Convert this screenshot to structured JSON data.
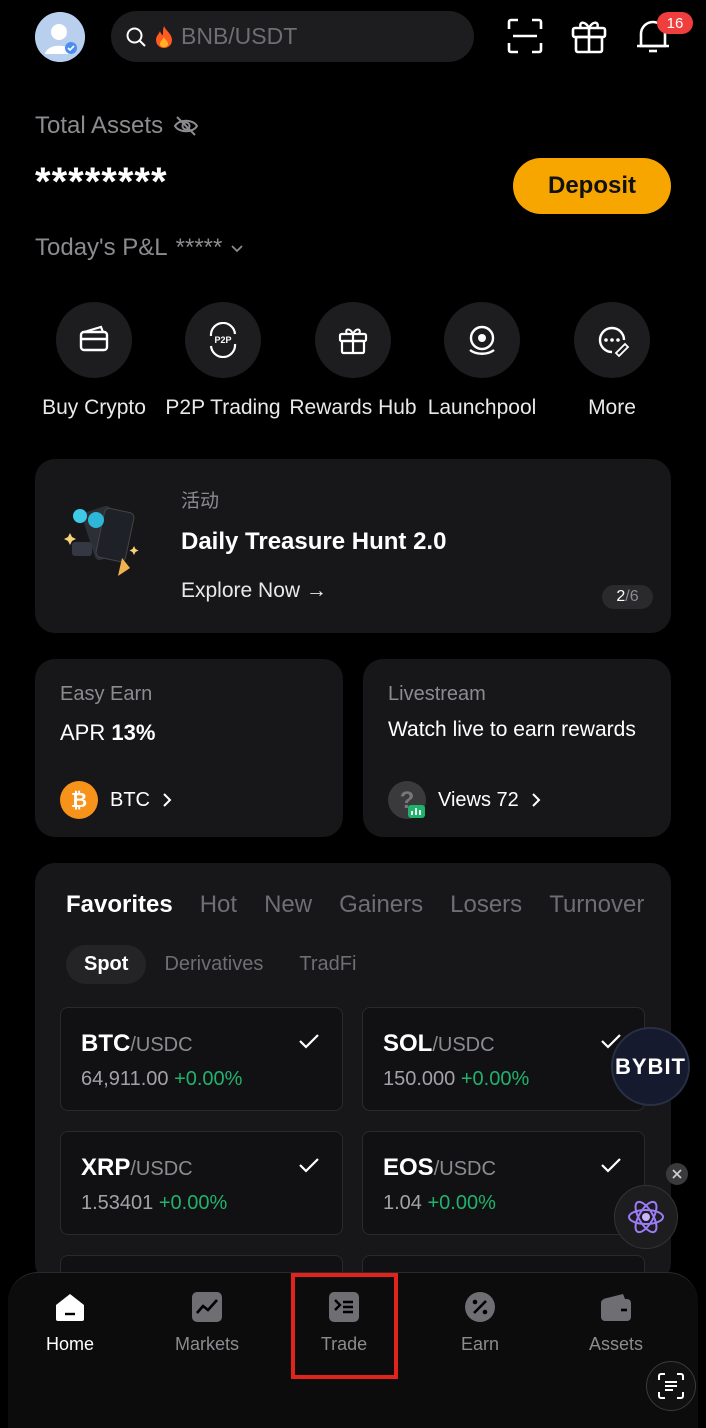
{
  "header": {
    "search_placeholder": "BNB/USDT",
    "notification_count": "16"
  },
  "assets": {
    "total_label": "Total Assets",
    "masked_value": "********",
    "deposit_label": "Deposit",
    "pnl_label": "Today's P&L",
    "pnl_value": "*****"
  },
  "shortcuts": [
    {
      "label": "Buy Crypto"
    },
    {
      "label": "P2P Trading"
    },
    {
      "label": "Rewards Hub"
    },
    {
      "label": "Launchpool"
    },
    {
      "label": "More"
    }
  ],
  "banner": {
    "tag": "活动",
    "title": "Daily Treasure Hunt 2.0",
    "link": "Explore Now →",
    "page_current": "2",
    "page_total": "/6"
  },
  "easy_earn": {
    "label": "Easy Earn",
    "apr_prefix": "APR",
    "apr_value": "13%",
    "coin": "BTC"
  },
  "livestream": {
    "label": "Livestream",
    "text": "Watch live to earn rewards",
    "views": "Views 72"
  },
  "market": {
    "tabs": [
      "Favorites",
      "Hot",
      "New",
      "Gainers",
      "Losers",
      "Turnover"
    ],
    "subtabs": [
      "Spot",
      "Derivatives",
      "TradFi"
    ],
    "pairs": [
      {
        "base": "BTC",
        "quote": "/USDC",
        "price": "64,911.00",
        "change": "+0.00%"
      },
      {
        "base": "SOL",
        "quote": "/USDC",
        "price": "150.000",
        "change": "+0.00%"
      },
      {
        "base": "XRP",
        "quote": "/USDC",
        "price": "1.53401",
        "change": "+0.00%"
      },
      {
        "base": "EOS",
        "quote": "/USDC",
        "price": "1.04",
        "change": "+0.00%"
      }
    ]
  },
  "floating": {
    "bybit_label": "BYBIT"
  },
  "nav": [
    {
      "label": "Home"
    },
    {
      "label": "Markets"
    },
    {
      "label": "Trade"
    },
    {
      "label": "Earn"
    },
    {
      "label": "Assets"
    }
  ],
  "colors": {
    "accent": "#f7a600",
    "positive": "#20b26c",
    "highlight": "#e0241b",
    "badge": "#f03d3d"
  }
}
